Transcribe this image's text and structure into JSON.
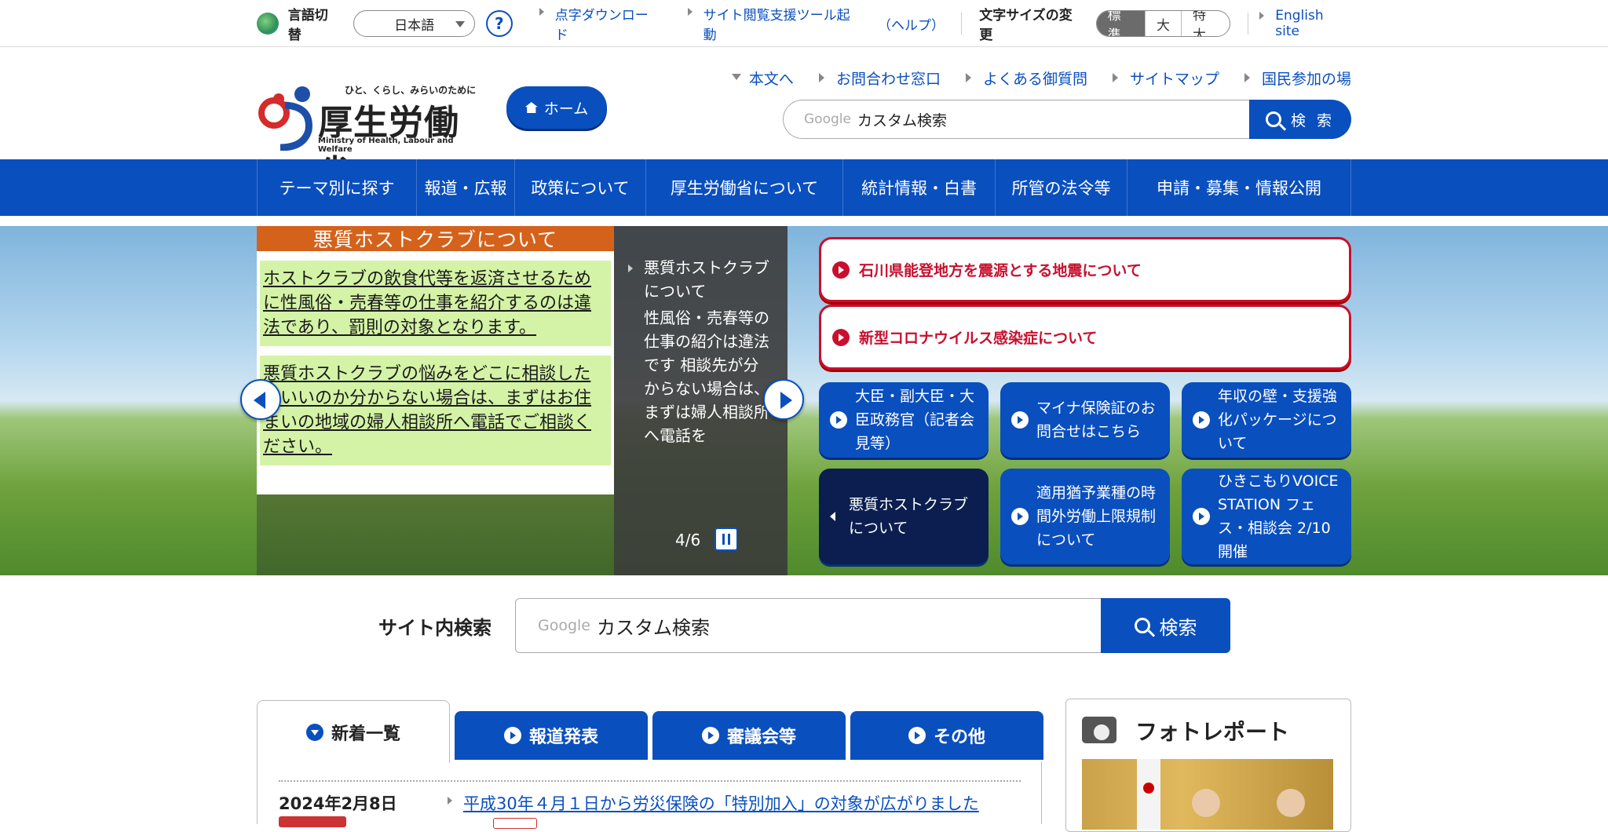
{
  "util": {
    "lang_label": "言語切替",
    "lang_value": "日本語",
    "help": "?",
    "braille": "点字ダウンロード",
    "support_tool": "サイト閲覧支援ツール起動",
    "support_help": "（ヘルプ）",
    "font_size_label": "文字サイズの変更",
    "font_sizes": [
      "標準",
      "大",
      "特大"
    ],
    "english": "English site"
  },
  "header": {
    "tagline": "ひと、くらし、みらいのために",
    "logo_ja": "厚生労働省",
    "logo_en": "Ministry of Health, Labour and Welfare",
    "home": "ホーム",
    "subnav": [
      "本文へ",
      "お問合わせ窓口",
      "よくある御質問",
      "サイトマップ",
      "国民参加の場"
    ],
    "search_google": "Google",
    "search_placeholder": "カスタム検索",
    "search_button": "検 索"
  },
  "mainnav": [
    "テーマ別に探す",
    "報道・広報",
    "政策について",
    "厚生労働省について",
    "統計情報・白書",
    "所管の法令等",
    "申請・募集・情報公開"
  ],
  "hero": {
    "slide_title": "悪質ホストクラブについて",
    "slide_text1": "ホストクラブの飲食代等を返済させるために性風俗・売春等の仕事を紹介するのは違法であり、罰則の対象となります。",
    "slide_text2": "悪質ホストクラブの悩みをどこに相談したらいいのか分からない場合は、まずはお住まいの地域の婦人相談所へ電話でご相談ください。",
    "caption_title": "悪質ホストクラブについて",
    "caption_body": "性風俗・売春等の仕事の紹介は違法です 相談先が分からない場合は、まずは婦人相談所へ電話を",
    "counter": "4/6",
    "alerts": [
      "石川県能登地方を震源とする地震について",
      "新型コロナウイルス感染症について"
    ],
    "tiles": [
      "大臣・副大臣・大臣政務官（記者会見等）",
      "マイナ保険証のお問合せはこちら",
      "年収の壁・支援強化パッケージについて",
      "悪質ホストクラブについて",
      "適用猶予業種の時間外労働上限規制について",
      "ひきこもりVOICE STATION フェス・相談会 2/10開催"
    ]
  },
  "site_search": {
    "label": "サイト内検索",
    "google": "Google",
    "placeholder": "カスタム検索",
    "button": "検索"
  },
  "news": {
    "tabs": [
      "新着一覧",
      "報道発表",
      "審議会等",
      "その他"
    ],
    "date": "2024年2月8日",
    "headline": "平成30年４月１日から労災保険の「特別加入」の対象が広がりました"
  },
  "photo": {
    "title": "フォトレポート"
  },
  "colors": {
    "primary": "#0a4fbe",
    "alert": "#c8102e",
    "dark_tile": "#0b1e4f"
  }
}
